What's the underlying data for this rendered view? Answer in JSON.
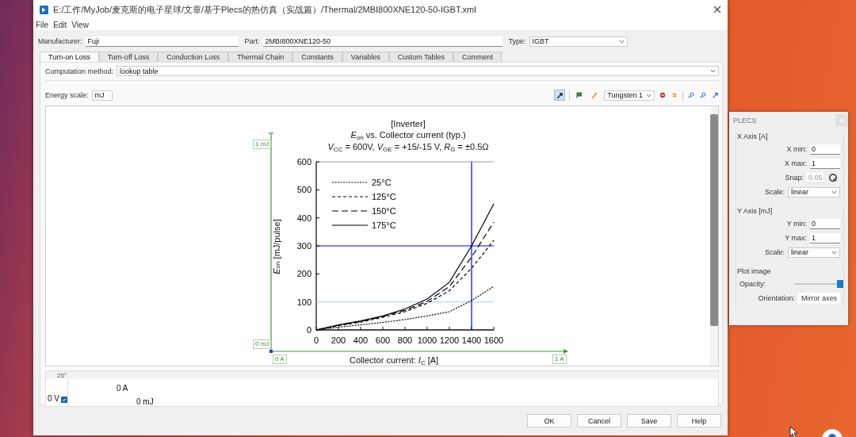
{
  "window": {
    "title": "E:/工作/MyJob/麦克斯的电子星球/文章/基于Plecs的热仿真（实战篇）/Thermal/2MBI800XNE120-50-IGBT.xml"
  },
  "menu": [
    "File",
    "Edit",
    "View"
  ],
  "device": {
    "manufacturer_label": "Manufacturer:",
    "manufacturer": "Fuji",
    "part_label": "Part:",
    "part": "2MBI800XNE120-50",
    "type_label": "Type:",
    "type": "IGBT"
  },
  "tabs": [
    {
      "label": "Turn-on Loss",
      "selected": true
    },
    {
      "label": "Turn-off Loss",
      "selected": false
    },
    {
      "label": "Conduction Loss",
      "selected": false
    },
    {
      "label": "Thermal Chain",
      "selected": false
    },
    {
      "label": "Constants",
      "selected": false
    },
    {
      "label": "Variables",
      "selected": false
    },
    {
      "label": "Custom Tables",
      "selected": false
    },
    {
      "label": "Comment",
      "selected": false
    }
  ],
  "computation": {
    "label": "Computation method:",
    "value": "lookup table"
  },
  "energy_scale": {
    "label": "Energy scale:",
    "value": "mJ"
  },
  "toolbar": {
    "tools": [
      {
        "kind": "pointer",
        "selected": true
      },
      {
        "kind": "flag",
        "selected": false
      },
      {
        "kind": "pencil",
        "selected": false
      }
    ],
    "line_combo": "Tungsten 1",
    "actions": [
      {
        "kind": "stop"
      },
      {
        "kind": "align"
      },
      {
        "kind": "zoom-in"
      },
      {
        "kind": "zoom-out"
      },
      {
        "kind": "arrow"
      }
    ]
  },
  "plot": {
    "subtitles": [
      "*E*$_{on}$ vs. Collector current  (typ.)",
      "*V*$_{CC}$ = 600V, *V*$_{GE}$ = +15/-15 V, *R*$_{G}$ = ±0.5Ω"
    ],
    "chart_data": {
      "type": "line",
      "title": "[Inverter]",
      "xlabel": "Collector current: *I*$_{C}$ [A]",
      "ylabel": "*E*$_{on}$ [mJ/pulse]",
      "x": [
        0,
        200,
        400,
        600,
        800,
        1000,
        1200,
        1400,
        1600
      ],
      "series": [
        {
          "name": "25°C",
          "color": "#000000",
          "line_style": "dotted",
          "values": [
            0,
            10,
            18,
            27,
            37,
            50,
            65,
            105,
            155
          ]
        },
        {
          "name": "125°C",
          "color": "#000000",
          "line_style": "dashed",
          "values": [
            0,
            15,
            28,
            45,
            65,
            95,
            140,
            220,
            320
          ]
        },
        {
          "name": "150°C",
          "color": "#000000",
          "line_style": "longdash",
          "values": [
            0,
            17,
            30,
            48,
            70,
            102,
            155,
            260,
            385
          ]
        },
        {
          "name": "175°C",
          "color": "#000000",
          "line_style": "solid",
          "values": [
            0,
            18,
            32,
            50,
            75,
            110,
            170,
            300,
            450
          ]
        }
      ],
      "xlim": [
        0,
        1600
      ],
      "ylim": [
        0,
        600
      ],
      "xticks": [
        0,
        200,
        400,
        600,
        800,
        1000,
        1200,
        1400,
        1600
      ],
      "yticks": [
        0,
        100,
        200,
        300,
        400,
        500,
        600
      ],
      "legend": "upper left",
      "ref_lines": [
        {
          "axis": "y",
          "value": 100,
          "color": "#c8d6f2"
        },
        {
          "axis": "x",
          "value": 1400,
          "color": "#0000ff"
        },
        {
          "axis": "y",
          "value": 300,
          "color": "#0000ff"
        }
      ]
    }
  },
  "calibration": {
    "y_top": "1 mJ",
    "y_bottom": "0 mJ",
    "x_left": "0 A",
    "x_right": "1 A"
  },
  "table": {
    "header": "25°",
    "current": "0 A",
    "voltage": "0 V",
    "checked": true,
    "energy": "0 mJ"
  },
  "buttons": [
    "OK",
    "Cancel",
    "Save",
    "Help"
  ],
  "plecs_panel": {
    "title": "PLECS",
    "x_axis": {
      "title": "X Axis [A]",
      "min_label": "X min:",
      "min": "0",
      "max_label": "X max:",
      "max": "1",
      "snap_label": "Snap:",
      "snap": "0.05",
      "snap_disabled": true,
      "scale_label": "Scale:",
      "scale": "linear"
    },
    "y_axis": {
      "title": "Y Axis [mJ]",
      "min_label": "Y min:",
      "min": "0",
      "max_label": "Y max:",
      "max": "1",
      "scale_label": "Scale:",
      "scale": "linear"
    },
    "image": {
      "title": "Plot image",
      "opacity_label": "Opacity:",
      "opacity": {
        "level": 1
      },
      "orientation_label": "Orientation:",
      "orientation": "Mirror axes"
    }
  }
}
